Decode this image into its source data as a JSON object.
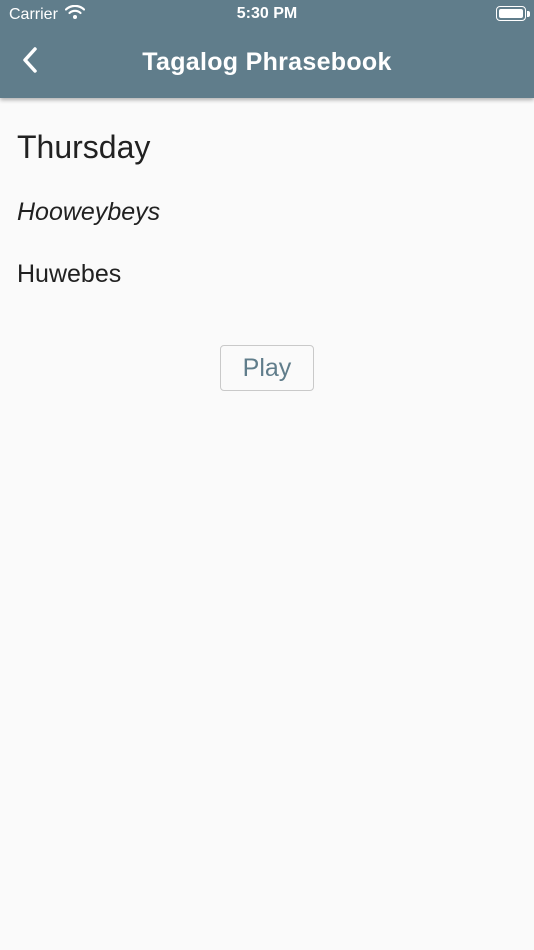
{
  "status_bar": {
    "carrier": "Carrier",
    "time": "5:30 PM",
    "wifi_icon": "wifi-icon",
    "battery_icon": "battery-icon"
  },
  "app_bar": {
    "title": "Tagalog Phrasebook",
    "back_icon": "chevron-left-icon",
    "background_color": "#607d8b"
  },
  "phrase": {
    "english": "Thursday",
    "pronunciation": "Hooweybeys",
    "tagalog": "Huwebes"
  },
  "actions": {
    "play_label": "Play"
  },
  "colors": {
    "accent": "#607d8b",
    "background": "#fafafa",
    "text": "#212121"
  }
}
